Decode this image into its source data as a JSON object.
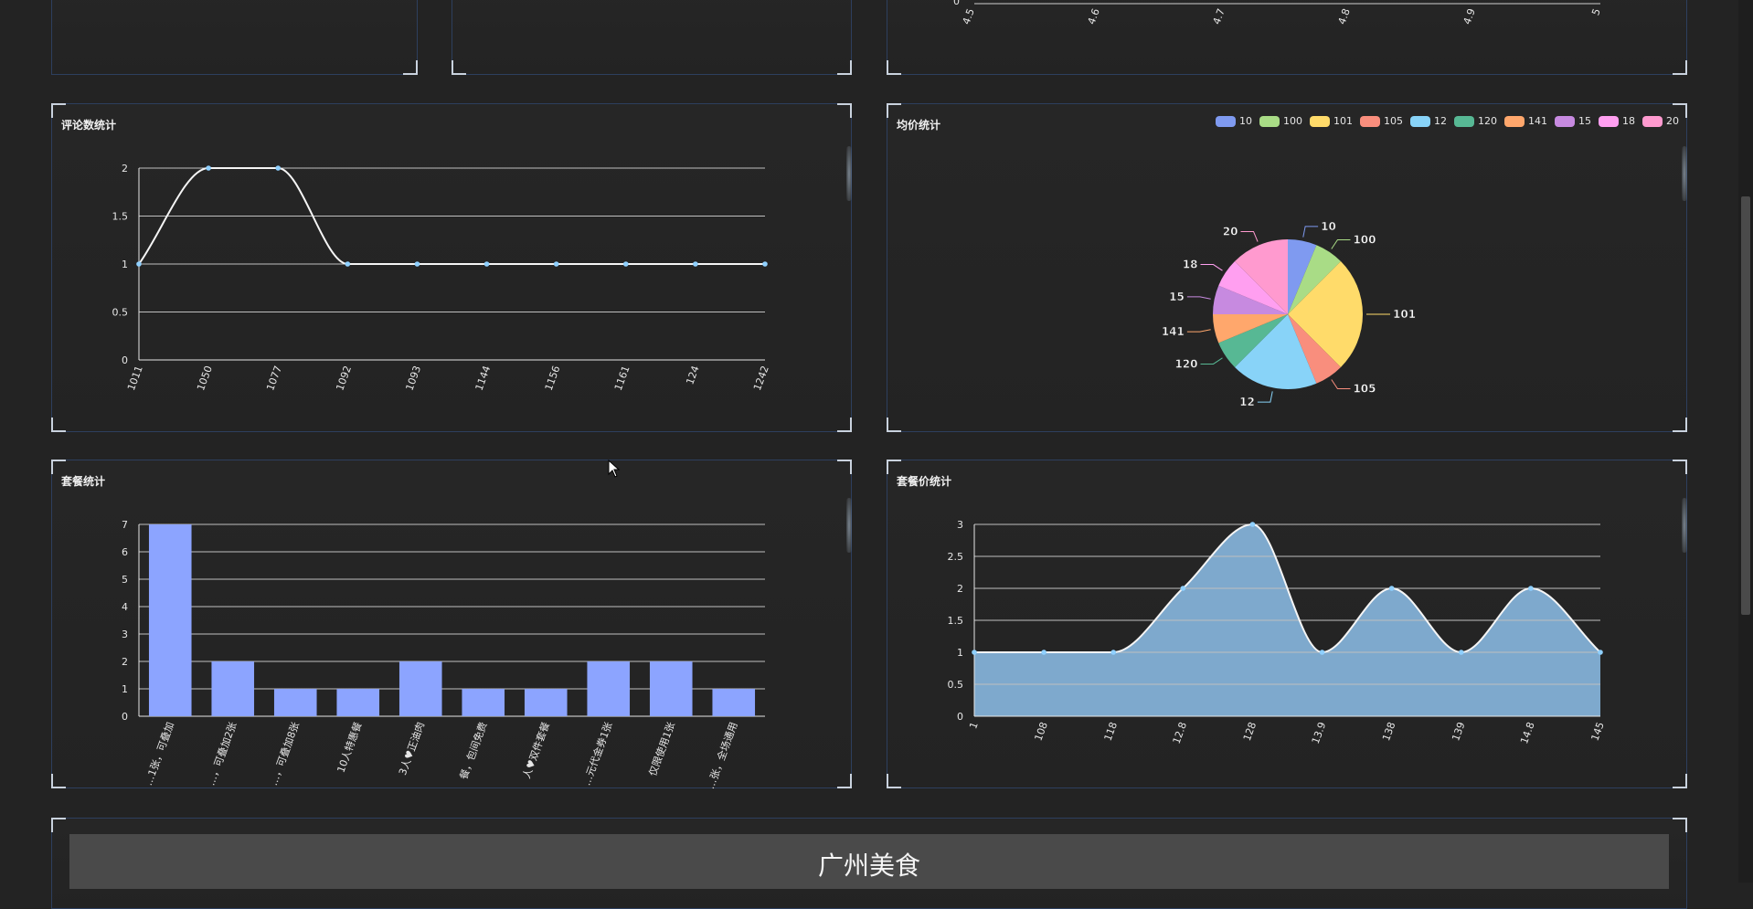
{
  "page": {
    "banner_title": "广州美食"
  },
  "top_chart": {
    "y_zero": "0",
    "x_ticks": [
      "4.5",
      "4.6",
      "4.7",
      "4.8",
      "4.9",
      "5"
    ]
  },
  "comments_chart": {
    "title": "评论数统计",
    "chart_data": {
      "type": "line",
      "categories": [
        "1011",
        "1050",
        "1077",
        "1092",
        "1093",
        "1144",
        "1156",
        "1161",
        "124",
        "1242"
      ],
      "values": [
        1,
        2,
        2,
        1,
        1,
        1,
        1,
        1,
        1,
        1
      ],
      "ylim": [
        0,
        2
      ],
      "yticks": [
        "0",
        "0.5",
        "1",
        "1.5",
        "2"
      ],
      "smooth": true,
      "grid": true
    }
  },
  "avg_price_chart": {
    "title": "均价统计",
    "chart_data": {
      "type": "pie",
      "legend_position": "top-right",
      "slices": [
        {
          "label": "10",
          "value": 1,
          "color": "#7f9af0"
        },
        {
          "label": "100",
          "value": 1,
          "color": "#a9dc86"
        },
        {
          "label": "101",
          "value": 4,
          "color": "#ffdb6a"
        },
        {
          "label": "105",
          "value": 1,
          "color": "#f98e7d"
        },
        {
          "label": "12",
          "value": 3,
          "color": "#88d3f8"
        },
        {
          "label": "120",
          "value": 1,
          "color": "#57b894"
        },
        {
          "label": "141",
          "value": 1,
          "color": "#ffa76c"
        },
        {
          "label": "15",
          "value": 1,
          "color": "#c78ae0"
        },
        {
          "label": "18",
          "value": 1,
          "color": "#ff9ff0"
        },
        {
          "label": "20",
          "value": 2,
          "color": "#ff9acf"
        }
      ]
    }
  },
  "package_chart": {
    "title": "套餐统计",
    "chart_data": {
      "type": "bar",
      "categories": [
        "…1张，可叠加",
        "…，可叠加2张",
        "…，可叠加8张",
        "10人特惠餐",
        "3人♥正油肉",
        "餐，包间免费",
        "人♥双件套餐",
        "…元代金券1张",
        "仅限使用1张",
        "…张，全场通用"
      ],
      "values": [
        7,
        2,
        1,
        1,
        2,
        1,
        1,
        2,
        2,
        1
      ],
      "ylim": [
        0,
        7
      ],
      "yticks": [
        "0",
        "1",
        "2",
        "3",
        "4",
        "5",
        "6",
        "7"
      ],
      "color": "#8ca4ff",
      "grid": true
    }
  },
  "package_price_chart": {
    "title": "套餐价统计",
    "chart_data": {
      "type": "area",
      "categories": [
        "1",
        "108",
        "118",
        "12.8",
        "128",
        "13.9",
        "138",
        "139",
        "14.8",
        "145"
      ],
      "values": [
        1,
        1,
        1,
        2,
        3,
        1,
        2,
        1,
        2,
        1
      ],
      "ylim": [
        0,
        3
      ],
      "yticks": [
        "0",
        "0.5",
        "1",
        "1.5",
        "2",
        "2.5",
        "3"
      ],
      "fill_color": "#7ea9cd",
      "smooth": true,
      "grid": true
    }
  }
}
